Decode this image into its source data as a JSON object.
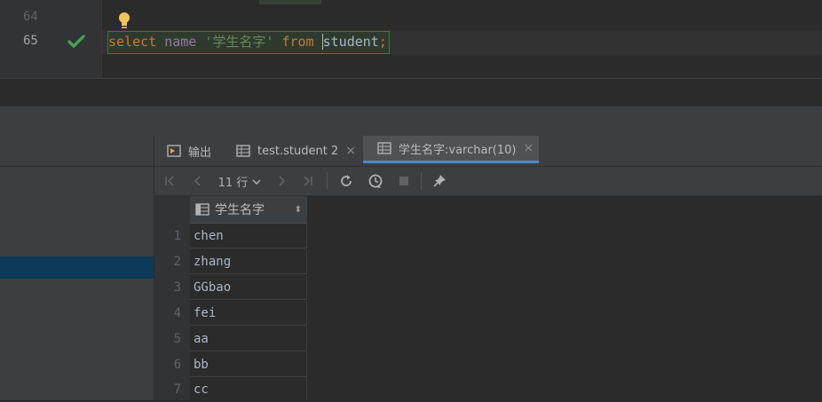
{
  "editor": {
    "lines": [
      {
        "number": "64"
      },
      {
        "number": "65"
      }
    ],
    "sql": {
      "kw_select": "select",
      "ident": "name",
      "string": "'学生名字'",
      "kw_from": "from",
      "table": "student",
      "semicolon": ";"
    }
  },
  "results": {
    "tabs": [
      {
        "label": "输出",
        "icon": "output-console-icon"
      },
      {
        "label": "test.student 2",
        "icon": "table-grid-icon",
        "close": "×"
      },
      {
        "label": "学生名字:varchar(10)",
        "icon": "table-grid-icon",
        "close": "×"
      }
    ],
    "toolbar": {
      "rows_label": "11 行",
      "icons": [
        "first-page-icon",
        "prev-page-icon",
        "next-page-icon",
        "last-page-icon",
        "refresh-icon",
        "history-icon",
        "stop-icon",
        "pin-icon"
      ]
    },
    "column": {
      "header": "学生名字",
      "sort_glyph": "⬍"
    },
    "rows": [
      {
        "num": "1",
        "value": "chen"
      },
      {
        "num": "2",
        "value": "zhang"
      },
      {
        "num": "3",
        "value": "GGbao"
      },
      {
        "num": "4",
        "value": "fei"
      },
      {
        "num": "5",
        "value": "aa"
      },
      {
        "num": "6",
        "value": "bb"
      },
      {
        "num": "7",
        "value": "cc"
      }
    ]
  },
  "colors": {
    "keyword": "#cc7832",
    "identifier": "#9876aa",
    "string": "#6a8759",
    "run_success": "#499c54",
    "accent": "#4a88c7"
  }
}
